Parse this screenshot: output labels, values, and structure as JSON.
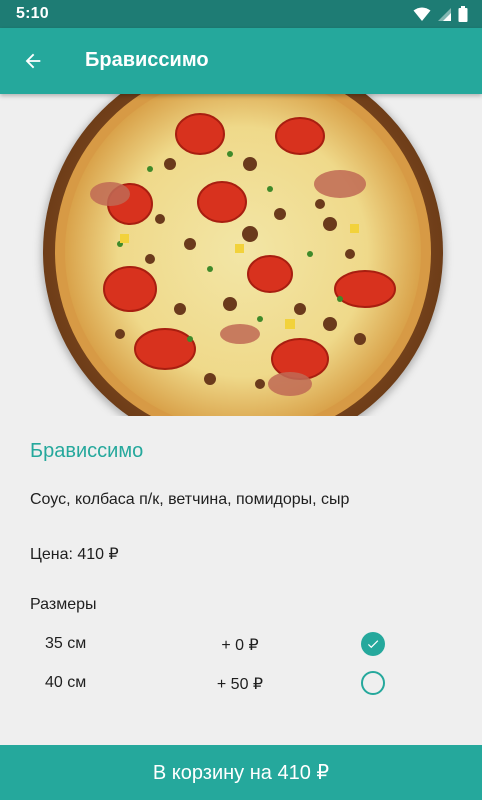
{
  "status_bar": {
    "time": "5:10",
    "icons": [
      "wifi-icon",
      "signal-icon",
      "battery-icon"
    ]
  },
  "app_bar": {
    "back_icon": "arrow-back-icon",
    "title": "Брависсимо"
  },
  "product": {
    "image": "pizza-photo",
    "name": "Брависсимо",
    "ingredients": "Соус, колбаса п/к, ветчина, помидоры, сыр",
    "price_text": "Цена: 410 ₽",
    "sizes_label": "Размеры",
    "sizes": [
      {
        "size": "35 см",
        "extra": "+ 0 ₽",
        "selected": true
      },
      {
        "size": "40 см",
        "extra": "+ 50 ₽",
        "selected": false
      }
    ]
  },
  "cart_button": {
    "label": "В корзину на 410 ₽"
  },
  "colors": {
    "accent": "#25a89c",
    "status_bar": "#1e7c74",
    "background": "#efefef"
  }
}
